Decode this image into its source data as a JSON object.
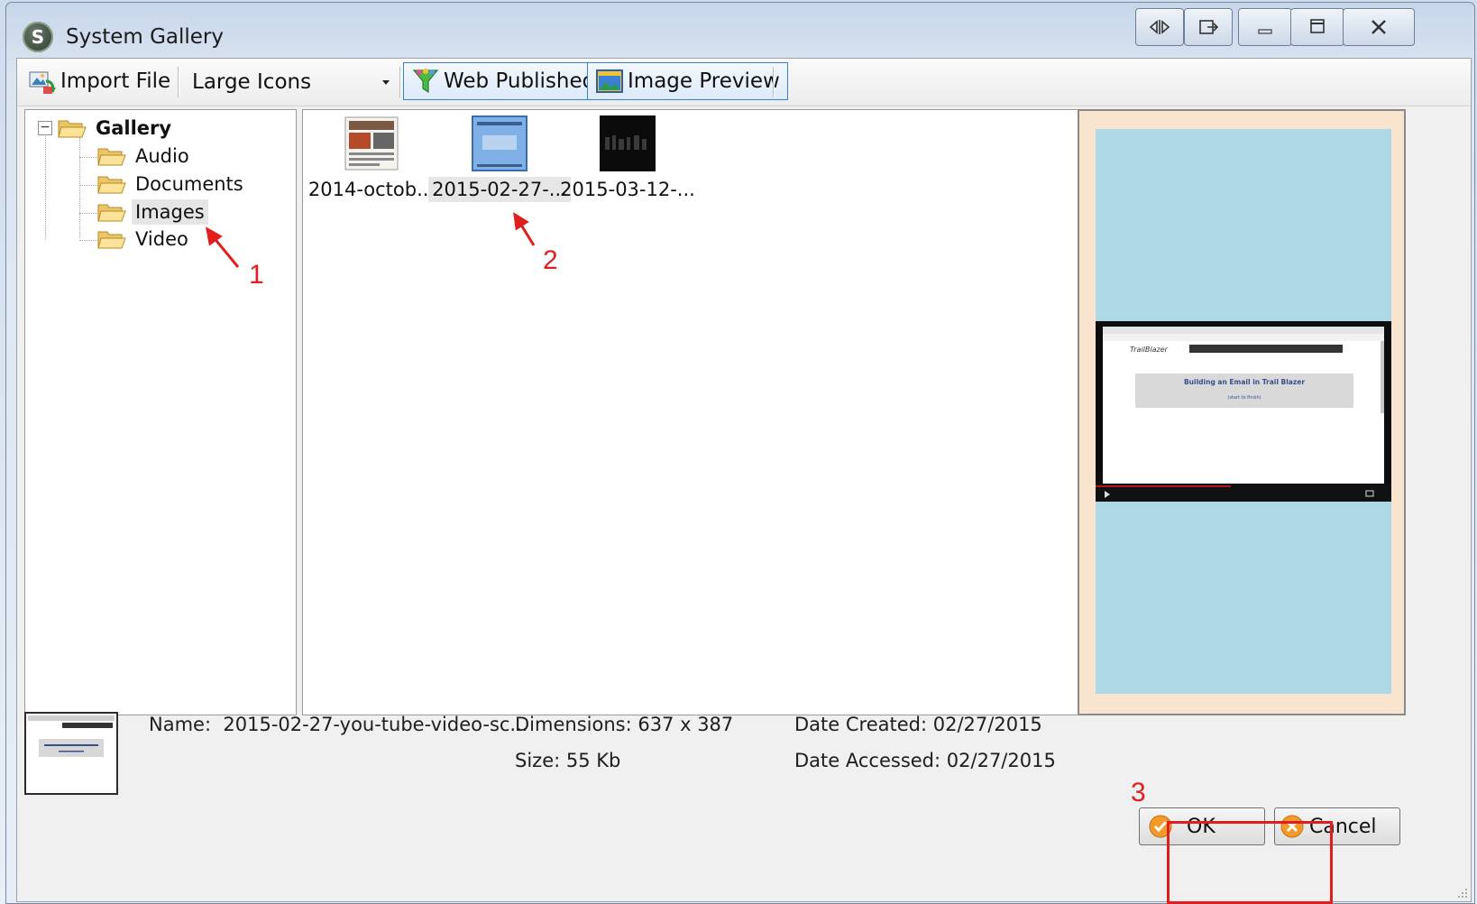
{
  "window": {
    "title": "System Gallery"
  },
  "toolbar": {
    "import_label": "Import File",
    "view_select": {
      "value": "Large Icons"
    },
    "web_published_label": "Web Published",
    "image_preview_label": "Image Preview"
  },
  "tree": {
    "root": "Gallery",
    "expander": "−",
    "folders": [
      "Audio",
      "Documents",
      "Images",
      "Video"
    ],
    "selected": "Images"
  },
  "files": [
    {
      "name": "2014-octob...",
      "icon": "newsletter-thumbnail"
    },
    {
      "name": "2015-02-27-...",
      "icon": "blue-screen-thumbnail",
      "selected": true
    },
    {
      "name": "2015-03-12-...",
      "icon": "dark-video-thumbnail"
    }
  ],
  "preview": {
    "page_heading": "Building an Email in Trail Blazer",
    "page_subheading": "(start to finish)",
    "logo_text": "TrailBlazer"
  },
  "details": {
    "name_label": "Name:",
    "name_value": "2015-02-27-you-tube-video-sc...",
    "dimensions_label": "Dimensions:",
    "dimensions_value": "637 x 387",
    "size_label": "Size:",
    "size_value": "55 Kb",
    "created_label": "Date Created:",
    "created_value": "02/27/2015",
    "accessed_label": "Date Accessed:",
    "accessed_value": "02/27/2015"
  },
  "buttons": {
    "ok": "OK",
    "cancel": "Cancel"
  },
  "annotations": [
    "1",
    "2",
    "3"
  ],
  "colors": {
    "annotation_red": "#e01e1e",
    "preview_bg": "#add8e6",
    "preview_frame": "#f8e4cf",
    "checked_border": "#3c7fd0"
  }
}
